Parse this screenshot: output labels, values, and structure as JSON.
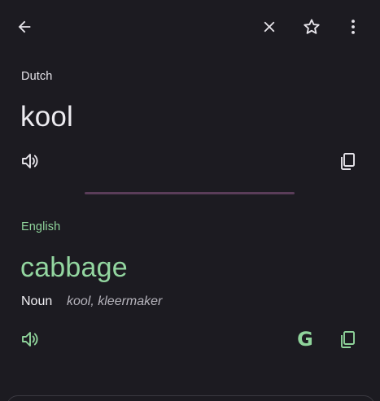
{
  "toolbar": {
    "back_icon": "arrow-back-icon",
    "close_icon": "close-icon",
    "star_icon": "star-outline-icon",
    "more_icon": "more-vert-icon"
  },
  "source": {
    "language": "Dutch",
    "text": "kool",
    "listen_icon": "volume-icon",
    "copy_icon": "copy-icon"
  },
  "translation": {
    "language": "English",
    "text": "cabbage",
    "part_of_speech": "Noun",
    "alternatives": "kool, kleermaker",
    "listen_icon": "volume-icon",
    "google_icon": "google-g-icon",
    "google_glyph": "G",
    "copy_icon": "copy-icon"
  },
  "colors": {
    "background": "#1c1b21",
    "accent_green": "#8fd49b",
    "divider": "#5a3d59"
  }
}
